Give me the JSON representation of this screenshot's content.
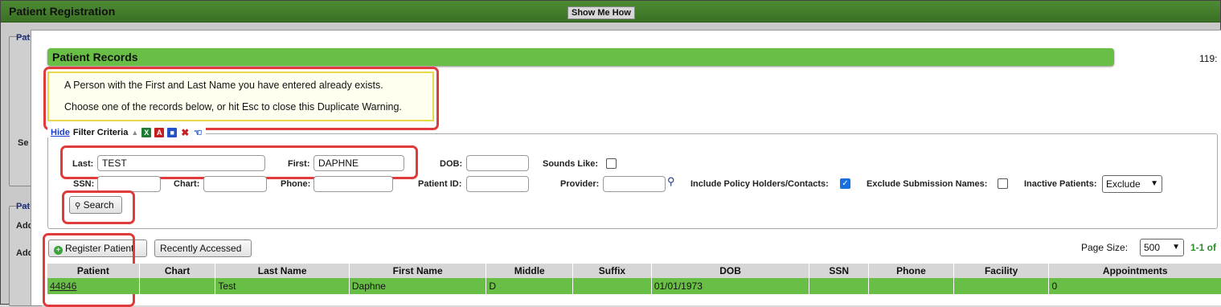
{
  "window": {
    "title": "Patient Registration",
    "show_me_how": "Show Me How"
  },
  "background": {
    "labels": [
      "Pat",
      "Se",
      "Pat",
      "Add",
      "Add"
    ]
  },
  "dialog": {
    "title": "Patient Records",
    "corner_text": "119:",
    "warning": {
      "line1": "A Person with the First and Last Name you have entered already exists.",
      "line2": "Choose one of the records below, or hit Esc to close this Duplicate Warning."
    },
    "filter": {
      "hide_link": "Hide",
      "legend_title": "Filter Criteria",
      "icons": [
        "collapse-arrow-icon",
        "excel-export-icon",
        "pdf-export-icon",
        "save-icon",
        "clear-filter-icon",
        "pointer-icon"
      ],
      "labels": {
        "last": "Last:",
        "first": "First:",
        "dob": "DOB:",
        "sounds_like": "Sounds Like:",
        "ssn": "SSN:",
        "chart": "Chart:",
        "phone": "Phone:",
        "patient_id": "Patient ID:",
        "provider": "Provider:",
        "include_policy": "Include Policy Holders/Contacts:",
        "exclude_submission": "Exclude Submission Names:",
        "inactive_patients": "Inactive Patients:"
      },
      "values": {
        "last": "TEST",
        "first": "DAPHNE",
        "dob": "",
        "ssn": "",
        "chart": "",
        "phone": "",
        "patient_id": "",
        "provider": ""
      },
      "checks": {
        "sounds_like": false,
        "include_policy": true,
        "exclude_submission": false
      },
      "inactive_patients_selected": "Exclude",
      "search_button": "Search"
    },
    "actions": {
      "register_patient": "Register Patient",
      "recently_accessed": "Recently Accessed"
    },
    "pagination": {
      "page_size_label": "Page Size:",
      "page_size": "500",
      "range": "1-1 of"
    },
    "table": {
      "columns": [
        "Patient",
        "Chart",
        "Last Name",
        "First Name",
        "Middle",
        "Suffix",
        "DOB",
        "SSN",
        "Phone",
        "Facility",
        "Appointments"
      ],
      "rows": [
        [
          "44846",
          "",
          "Test",
          "Daphne",
          "D",
          "",
          "01/01/1973",
          "",
          "",
          "",
          "0"
        ]
      ]
    }
  },
  "colors": {
    "accent_green": "#69bf46",
    "title_green": "#3f7a28",
    "highlight_red": "#e03a3a",
    "warning_border": "#e8d84a"
  }
}
